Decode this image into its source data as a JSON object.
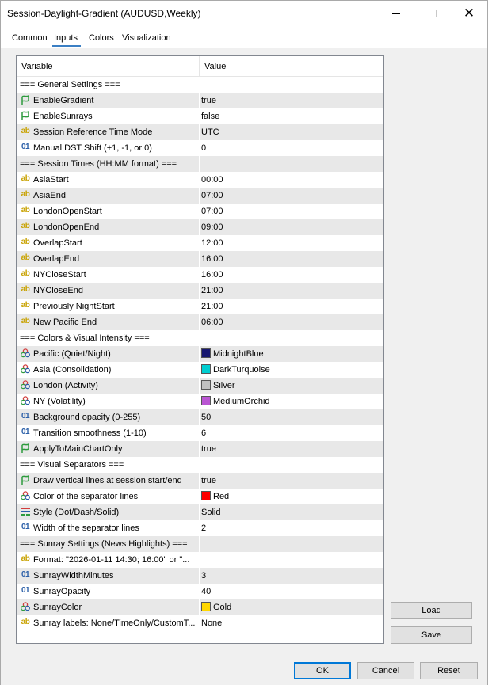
{
  "window": {
    "title": "Session-Daylight-Gradient (AUDUSD,Weekly)"
  },
  "tabs": [
    {
      "label": "Common"
    },
    {
      "label": "Inputs"
    },
    {
      "label": "Colors"
    },
    {
      "label": "Visualization"
    }
  ],
  "active_tab": "Inputs",
  "grid": {
    "header": {
      "variable": "Variable",
      "value": "Value"
    },
    "rows": [
      {
        "icon": "none",
        "name": "=== General Settings ===",
        "value": ""
      },
      {
        "icon": "bool",
        "name": "EnableGradient",
        "value": "true"
      },
      {
        "icon": "bool",
        "name": "EnableSunrays",
        "value": "false"
      },
      {
        "icon": "ab",
        "name": "Session Reference Time Mode",
        "value": "UTC"
      },
      {
        "icon": "num",
        "name": "Manual DST Shift (+1, -1, or 0)",
        "value": "0"
      },
      {
        "icon": "none",
        "name": "=== Session Times (HH:MM format) ===",
        "value": ""
      },
      {
        "icon": "ab",
        "name": "AsiaStart",
        "value": "00:00"
      },
      {
        "icon": "ab",
        "name": "AsiaEnd",
        "value": "07:00"
      },
      {
        "icon": "ab",
        "name": "LondonOpenStart",
        "value": "07:00"
      },
      {
        "icon": "ab",
        "name": "LondonOpenEnd",
        "value": "09:00"
      },
      {
        "icon": "ab",
        "name": "OverlapStart",
        "value": "12:00"
      },
      {
        "icon": "ab",
        "name": "OverlapEnd",
        "value": "16:00"
      },
      {
        "icon": "ab",
        "name": "NYCloseStart",
        "value": "16:00"
      },
      {
        "icon": "ab",
        "name": "NYCloseEnd",
        "value": "21:00"
      },
      {
        "icon": "ab",
        "name": "Previously NightStart",
        "value": "21:00"
      },
      {
        "icon": "ab",
        "name": "New Pacific End",
        "value": "06:00"
      },
      {
        "icon": "none",
        "name": "=== Colors & Visual Intensity ===",
        "value": ""
      },
      {
        "icon": "color",
        "name": "Pacific (Quiet/Night)",
        "value": "MidnightBlue",
        "swatch": "#191970"
      },
      {
        "icon": "color",
        "name": "Asia (Consolidation)",
        "value": "DarkTurquoise",
        "swatch": "#00ced1"
      },
      {
        "icon": "color",
        "name": "London (Activity)",
        "value": "Silver",
        "swatch": "#c0c0c0"
      },
      {
        "icon": "color",
        "name": "NY (Volatility)",
        "value": "MediumOrchid",
        "swatch": "#ba55d3"
      },
      {
        "icon": "num",
        "name": "Background opacity (0-255)",
        "value": "50"
      },
      {
        "icon": "num",
        "name": "Transition smoothness (1-10)",
        "value": "6"
      },
      {
        "icon": "bool",
        "name": "ApplyToMainChartOnly",
        "value": "true"
      },
      {
        "icon": "none",
        "name": "=== Visual Separators ===",
        "value": ""
      },
      {
        "icon": "bool",
        "name": "Draw vertical lines at session start/end",
        "value": "true"
      },
      {
        "icon": "color",
        "name": "Color of the separator lines",
        "value": "Red",
        "swatch": "#ff0000"
      },
      {
        "icon": "style",
        "name": "Style (Dot/Dash/Solid)",
        "value": "Solid"
      },
      {
        "icon": "num",
        "name": "Width of the separator lines",
        "value": "2"
      },
      {
        "icon": "none",
        "name": "=== Sunray Settings (News Highlights) ===",
        "value": ""
      },
      {
        "icon": "ab",
        "name": "Format: \"2026-01-11 14:30; 16:00\" or \"...",
        "value": ""
      },
      {
        "icon": "num",
        "name": "SunrayWidthMinutes",
        "value": "3"
      },
      {
        "icon": "num",
        "name": "SunrayOpacity",
        "value": "40"
      },
      {
        "icon": "color",
        "name": "SunrayColor",
        "value": "Gold",
        "swatch": "#ffd700"
      },
      {
        "icon": "ab",
        "name": "Sunray labels: None/TimeOnly/CustomT...",
        "value": "None"
      }
    ]
  },
  "side_buttons": {
    "load": "Load",
    "save": "Save"
  },
  "footer_buttons": {
    "ok": "OK",
    "cancel": "Cancel",
    "reset": "Reset"
  },
  "colors": {
    "accent": "#0078d7",
    "bool_icon": "#2e9b3e",
    "ab_icon": "#c8a200",
    "num_icon": "#2b5fa8"
  }
}
